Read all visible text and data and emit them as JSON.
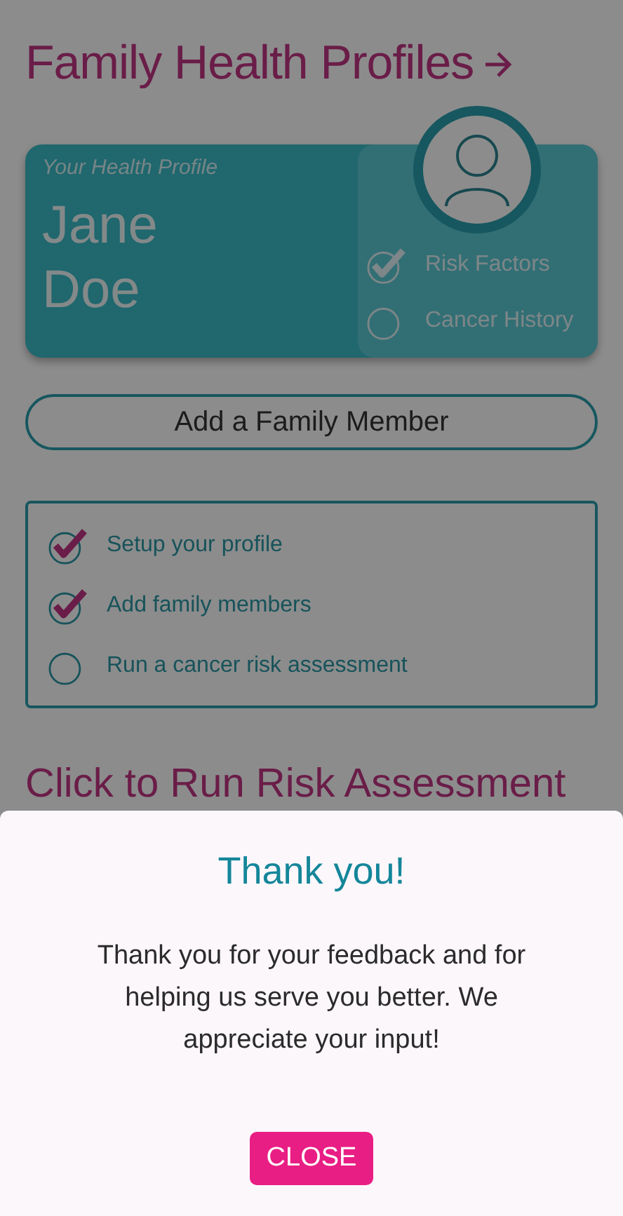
{
  "header": {
    "title": "Family Health Profiles"
  },
  "profile_card": {
    "label": "Your Health Profile",
    "first_name": "Jane",
    "last_name": "Doe",
    "checks": [
      {
        "label": "Risk Factors",
        "checked": true
      },
      {
        "label": "Cancer History",
        "checked": false
      }
    ]
  },
  "add_button": "Add a Family Member",
  "checklist": [
    {
      "label": "Setup your profile",
      "checked": true
    },
    {
      "label": "Add family members",
      "checked": true
    },
    {
      "label": "Run a cancer risk assessment",
      "checked": false
    }
  ],
  "run_link": "Click to Run Risk Assessment",
  "dialog": {
    "title": "Thank you!",
    "message": "Thank you for your feedback and for helping us serve you better. We appreciate your input!",
    "button": "CLOSE"
  }
}
